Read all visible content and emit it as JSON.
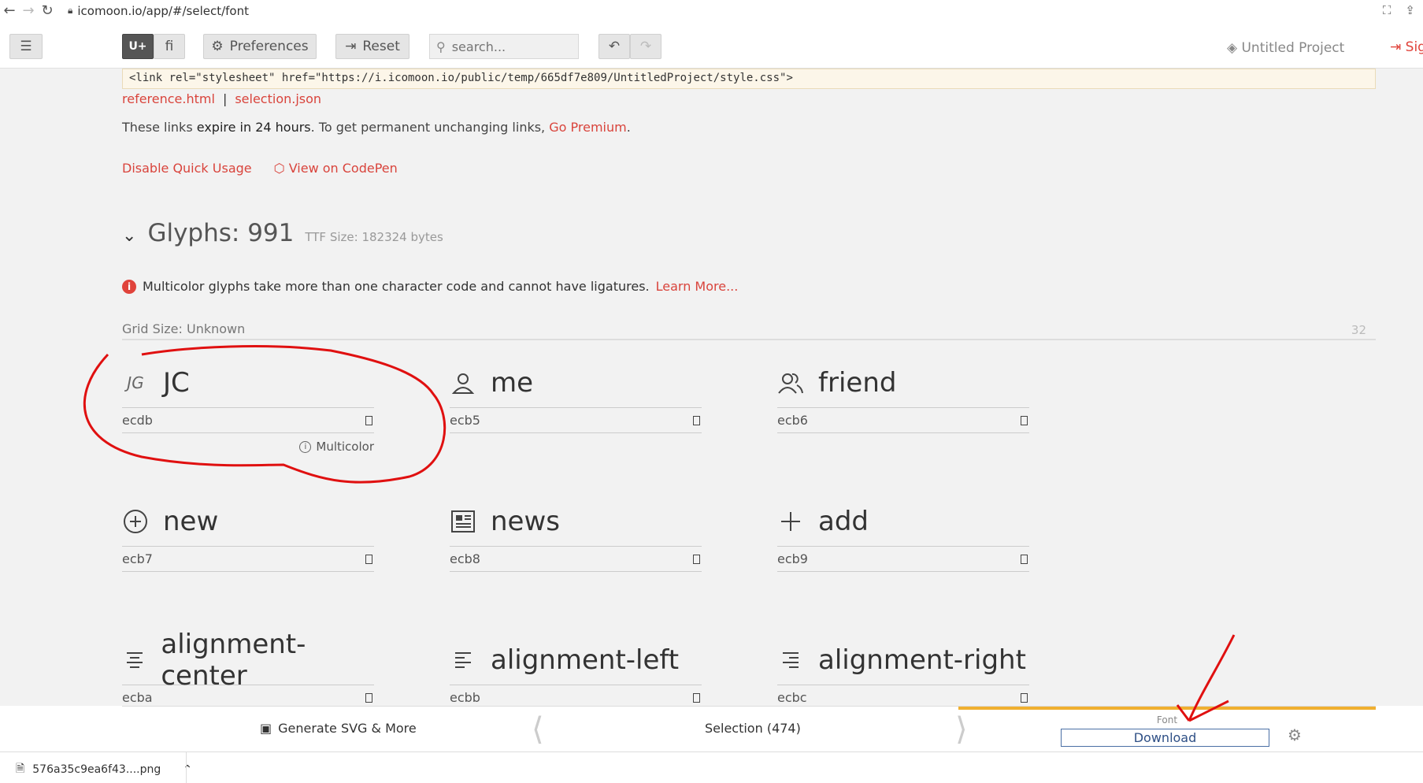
{
  "browser": {
    "url": "icomoon.io/app/#/select/font"
  },
  "toolbar": {
    "unicode_label": "U+",
    "ligature_label": "ﬁ",
    "preferences_label": "Preferences",
    "reset_label": "Reset",
    "search_placeholder": "search...",
    "project_name": "Untitled Project",
    "signin_label": "Sig"
  },
  "quick_usage": {
    "code": "<link rel=\"stylesheet\" href=\"https://i.icomoon.io/public/temp/665df7e809/UntitledProject/style.css\">",
    "link_reference": "reference.html",
    "link_sep": "|",
    "link_selection": "selection.json",
    "expire_prefix": "These links ",
    "expire_bold": "expire in 24 hours",
    "expire_middle": ". To get permanent unchanging links, ",
    "go_premium": "Go Premium",
    "expire_end": ".",
    "disable_label": "Disable Quick Usage",
    "codepen_label": "View on CodePen"
  },
  "glyphs": {
    "title": "Glyphs: 991",
    "ttf_size": "TTF Size: 182324 bytes",
    "notice_text": "Multicolor glyphs take more than one character code and cannot have ligatures.",
    "learn_more": "Learn More...",
    "grid_size": "Grid Size: Unknown",
    "grid_value": "32",
    "multicolor_label": "Multicolor",
    "items": [
      {
        "name": "JC",
        "code": "ecdb",
        "icon": "jc-monogram-icon"
      },
      {
        "name": "me",
        "code": "ecb5",
        "icon": "user-icon"
      },
      {
        "name": "friend",
        "code": "ecb6",
        "icon": "users-icon"
      },
      {
        "name": "new",
        "code": "ecb7",
        "icon": "plus-circle-icon"
      },
      {
        "name": "news",
        "code": "ecb8",
        "icon": "newspaper-icon"
      },
      {
        "name": "add",
        "code": "ecb9",
        "icon": "plus-icon"
      },
      {
        "name": "alignment-center",
        "code": "ecba",
        "icon": "align-center-icon"
      },
      {
        "name": "alignment-left",
        "code": "ecbb",
        "icon": "align-left-icon"
      },
      {
        "name": "alignment-right",
        "code": "ecbc",
        "icon": "align-right-icon"
      }
    ]
  },
  "bottom_bar": {
    "generate_label": "Generate SVG & More",
    "selection_label": "Selection (474)",
    "font_label": "Font",
    "download_label": "Download"
  },
  "downloads": {
    "file_name": "576a35c9ea6f43....png"
  },
  "colors": {
    "accent_red": "#d9443c",
    "annotation_red": "#e01010",
    "font_tab_underline": "#f0b030"
  }
}
